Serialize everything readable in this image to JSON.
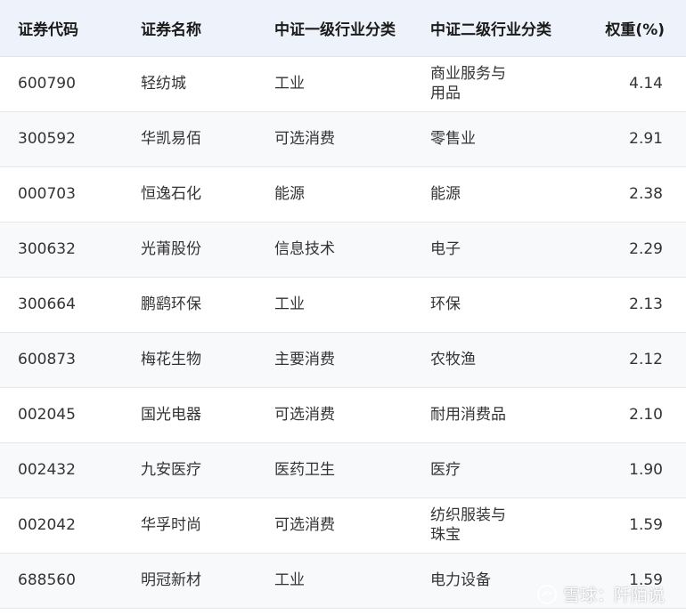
{
  "headers": [
    "证券代码",
    "证券名称",
    "中证一级行业分类",
    "中证二级行业分类",
    "权重(%)"
  ],
  "rows": [
    {
      "code": "600790",
      "name": "轻纺城",
      "l1": "工业",
      "l2": "商业服务与用品",
      "weight": "4.14"
    },
    {
      "code": "300592",
      "name": "华凯易佰",
      "l1": "可选消费",
      "l2": "零售业",
      "weight": "2.91"
    },
    {
      "code": "000703",
      "name": "恒逸石化",
      "l1": "能源",
      "l2": "能源",
      "weight": "2.38"
    },
    {
      "code": "300632",
      "name": "光莆股份",
      "l1": "信息技术",
      "l2": "电子",
      "weight": "2.29"
    },
    {
      "code": "300664",
      "name": "鹏鹞环保",
      "l1": "工业",
      "l2": "环保",
      "weight": "2.13"
    },
    {
      "code": "600873",
      "name": "梅花生物",
      "l1": "主要消费",
      "l2": "农牧渔",
      "weight": "2.12"
    },
    {
      "code": "002045",
      "name": "国光电器",
      "l1": "可选消费",
      "l2": "耐用消费品",
      "weight": "2.10"
    },
    {
      "code": "002432",
      "name": "九安医疗",
      "l1": "医药卫生",
      "l2": "医疗",
      "weight": "1.90"
    },
    {
      "code": "002042",
      "name": "华孚时尚",
      "l1": "可选消费",
      "l2": "纺织服装与珠宝",
      "weight": "1.59"
    },
    {
      "code": "688560",
      "name": "明冠新材",
      "l1": "工业",
      "l2": "电力设备",
      "weight": "1.59"
    }
  ],
  "watermark": {
    "text": "雪球：阡陌说",
    "icon": "snowball-logo-icon"
  }
}
